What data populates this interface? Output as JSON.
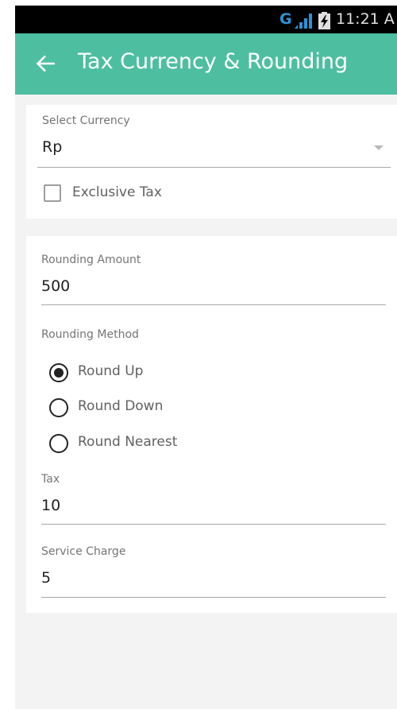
{
  "status_bar": {
    "network": "G",
    "time": "11:21 A"
  },
  "app_bar": {
    "title": "Tax Currency & Rounding"
  },
  "currency_card": {
    "select_currency_label": "Select Currency",
    "currency_value": "Rp",
    "exclusive_tax_label": "Exclusive Tax",
    "exclusive_tax_checked": false
  },
  "rounding_card": {
    "rounding_amount_label": "Rounding Amount",
    "rounding_amount_value": "500",
    "rounding_method_label": "Rounding Method",
    "rounding_options": [
      {
        "label": "Round Up",
        "checked": true
      },
      {
        "label": "Round Down",
        "checked": false
      },
      {
        "label": "Round Nearest",
        "checked": false
      }
    ],
    "tax_label": "Tax",
    "tax_value": "10",
    "service_charge_label": "Service Charge",
    "service_charge_value": "5"
  },
  "colors": {
    "app_bar": "#4dbfa0",
    "status_bar": "#000000",
    "network_indicator": "#2a93d5",
    "background": "#f3f3f3",
    "card": "#ffffff"
  },
  "icons": {
    "back": "arrow-left-icon",
    "signal": "signal-bars-icon",
    "battery": "battery-charging-icon",
    "dropdown": "chevron-down-icon"
  }
}
